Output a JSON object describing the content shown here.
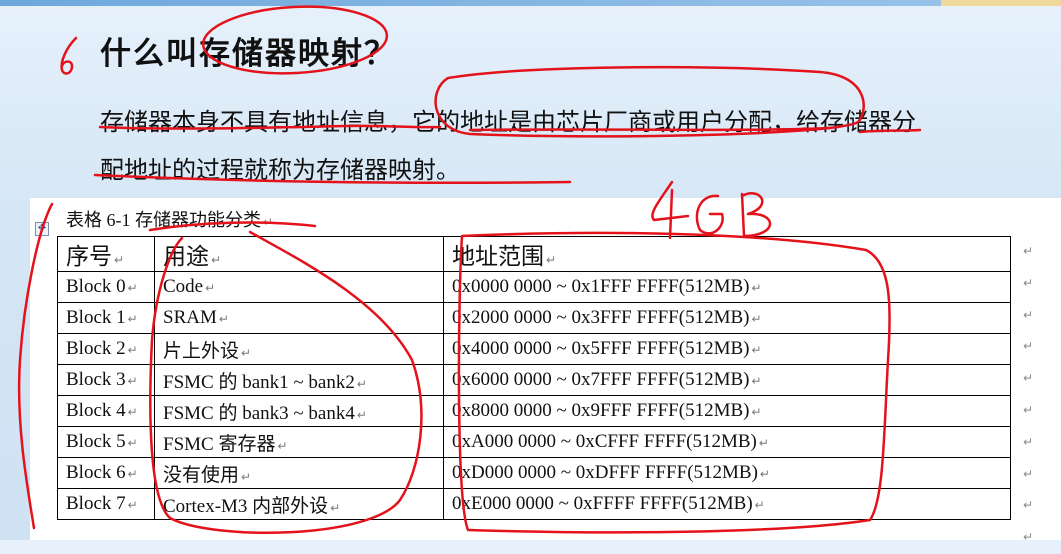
{
  "slide": {
    "title": "什么叫存储器映射？",
    "paragraph": "存储器本身不具有地址信息，它的地址是由芯片厂商或用户分配，给存储器分配地址的过程就称为存储器映射。"
  },
  "table": {
    "caption": "表格 6-1 存储器功能分类",
    "headers": [
      "序号",
      "用途",
      "地址范围"
    ],
    "rows": [
      [
        "Block 0",
        "Code",
        "0x0000 0000 ~ 0x1FFF FFFF(512MB)"
      ],
      [
        "Block 1",
        "SRAM",
        "0x2000 0000 ~ 0x3FFF FFFF(512MB)"
      ],
      [
        "Block 2",
        "片上外设",
        "0x4000 0000 ~ 0x5FFF FFFF(512MB)"
      ],
      [
        "Block 3",
        "FSMC 的 bank1 ~ bank2",
        "0x6000 0000 ~ 0x7FFF FFFF(512MB)"
      ],
      [
        "Block 4",
        "FSMC 的 bank3 ~ bank4",
        "0x8000 0000 ~ 0x9FFF FFFF(512MB)"
      ],
      [
        "Block 5",
        "FSMC 寄存器",
        "0xA000 0000 ~ 0xCFFF FFFF(512MB)"
      ],
      [
        "Block 6",
        "没有使用",
        "0xD000 0000 ~ 0xDFFF FFFF(512MB)"
      ],
      [
        "Block 7",
        "Cortex-M3 内部外设",
        "0xE000 0000 ~ 0xFFFF FFFF(512MB)"
      ]
    ]
  },
  "annotations": {
    "number": "6",
    "size_note": "4GB",
    "ink_color": "#e3121b"
  }
}
